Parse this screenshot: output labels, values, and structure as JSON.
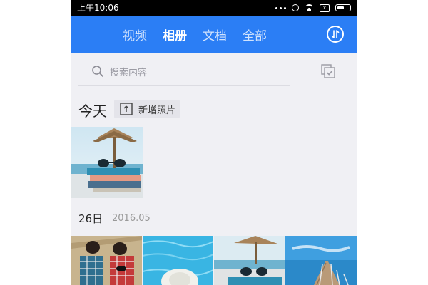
{
  "status_bar": {
    "time": "上午10:06",
    "sim_label": "x"
  },
  "header": {
    "tabs": [
      {
        "label": "视频",
        "active": false
      },
      {
        "label": "相册",
        "active": true
      },
      {
        "label": "文档",
        "active": false
      },
      {
        "label": "全部",
        "active": false
      }
    ],
    "accent_color": "#2b7ef5"
  },
  "search": {
    "placeholder": "搜索内容"
  },
  "today_section": {
    "title": "今天",
    "add_button_label": "新增照片"
  },
  "date_group": {
    "day": "26日",
    "month": "2016.05"
  },
  "icons": [
    "search-icon",
    "multi-select-icon",
    "upload-icon",
    "sort-icon",
    "alarm-icon",
    "wifi-icon",
    "battery-icon"
  ]
}
